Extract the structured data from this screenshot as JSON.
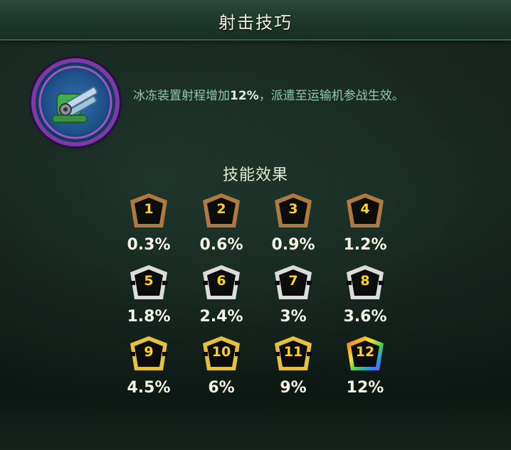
{
  "header": {
    "title": "射击技巧"
  },
  "skill": {
    "icon": "frost-turret-icon",
    "description_prefix": "冰冻装置射程增加",
    "description_highlight": "12%",
    "description_suffix": "，派遣至运输机参战生效。"
  },
  "effects": {
    "title": "技能效果",
    "levels": [
      {
        "level": "1",
        "value": "0.3%",
        "tier": "bronze"
      },
      {
        "level": "2",
        "value": "0.6%",
        "tier": "bronze"
      },
      {
        "level": "3",
        "value": "0.9%",
        "tier": "bronze"
      },
      {
        "level": "4",
        "value": "1.2%",
        "tier": "bronze"
      },
      {
        "level": "5",
        "value": "1.8%",
        "tier": "silver"
      },
      {
        "level": "6",
        "value": "2.4%",
        "tier": "silver"
      },
      {
        "level": "7",
        "value": "3%",
        "tier": "silver"
      },
      {
        "level": "8",
        "value": "3.6%",
        "tier": "silver"
      },
      {
        "level": "9",
        "value": "4.5%",
        "tier": "gold"
      },
      {
        "level": "10",
        "value": "6%",
        "tier": "gold"
      },
      {
        "level": "11",
        "value": "9%",
        "tier": "gold"
      },
      {
        "level": "12",
        "value": "12%",
        "tier": "rainbow"
      }
    ]
  },
  "colors": {
    "bronze": "#b07a3e",
    "silver": "#dcdcdc",
    "gold": "#e6c23a",
    "number": "#ffd21f",
    "description": "#8fc7b3"
  }
}
